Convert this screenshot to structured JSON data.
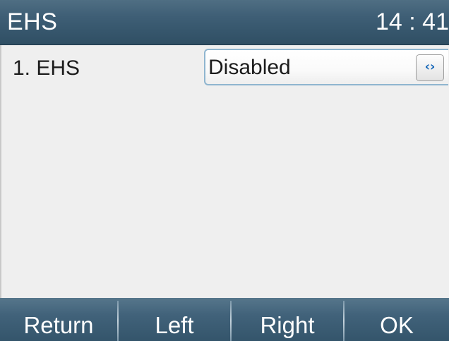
{
  "titlebar": {
    "title": "EHS",
    "clock": "14 : 41"
  },
  "settings": {
    "rows": [
      {
        "label": "1. EHS",
        "value": "Disabled",
        "control_icon": "left-right-arrows-icon",
        "control_glyph": "‹›"
      }
    ]
  },
  "softkeys": {
    "return_label": "Return",
    "left_label": "Left",
    "right_label": "Right",
    "ok_label": "OK"
  },
  "colors": {
    "titlebar": "#3f5f76",
    "softkey_bar": "#41627a",
    "content_bg": "#efefef",
    "select_border": "#8fb5cf",
    "arrow_glyph": "#1466b8"
  }
}
